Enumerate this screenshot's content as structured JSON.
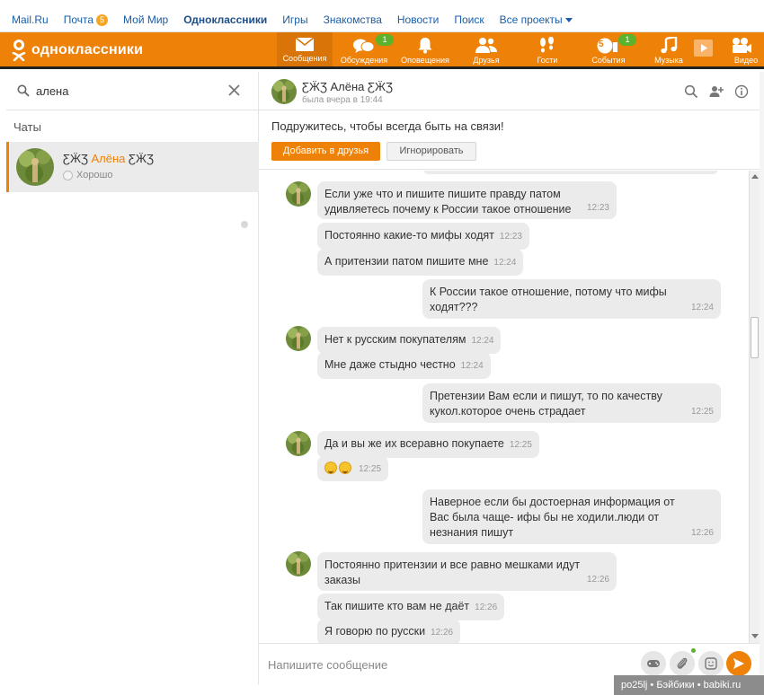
{
  "topbar": {
    "links": [
      "Mail.Ru",
      "Почта",
      "Мой Мир",
      "Одноклассники",
      "Игры",
      "Знакомства",
      "Новости",
      "Поиск",
      "Все проекты"
    ],
    "mail_badge": "5"
  },
  "header": {
    "logo_text": "одноклассники",
    "nav": [
      {
        "label": "Сообщения",
        "badge": ""
      },
      {
        "label": "Обсуждения",
        "badge": "1"
      },
      {
        "label": "Оповещения",
        "badge": ""
      },
      {
        "label": "Друзья",
        "badge": ""
      },
      {
        "label": "Гости",
        "badge": ""
      },
      {
        "label": "События",
        "badge": "1"
      },
      {
        "label": "Музыка",
        "badge": ""
      },
      {
        "label": "Видео",
        "badge": ""
      }
    ],
    "events_counter": "5"
  },
  "sidebar": {
    "search_value": "алена",
    "chats_heading": "Чаты",
    "chat": {
      "name_prefix": "ƸӜƷ ",
      "name_highlight": "Алёна",
      "name_suffix": " ƸӜƷ",
      "status": "Хорошо"
    }
  },
  "conversation": {
    "name": "ƸӜƷ Алёна ƸӜƷ",
    "last_seen": "была вчера в 19:44",
    "friend_prompt": "Подружитесь, чтобы всегда быть на связи!",
    "add_friend_label": "Добавить в друзья",
    "ignore_label": "Игнорировать",
    "composer_placeholder": "Напишите сообщение",
    "messages": [
      {
        "from": "them",
        "text": "Если уже что и пишите пишите правду патом удивляетесь почему к России такое отношение",
        "time": "12:23"
      },
      {
        "from": "them",
        "text": "Постоянно какие-то мифы ходят",
        "time": "12:23"
      },
      {
        "from": "them",
        "text": "А притензии патом пишите мне",
        "time": "12:24"
      },
      {
        "from": "me",
        "text": "К России такое отношение, потому что мифы ходят???",
        "time": "12:24"
      },
      {
        "from": "them",
        "text": "Нет к русским покупателям",
        "time": "12:24"
      },
      {
        "from": "them",
        "text": "Мне даже стыдно честно",
        "time": "12:24"
      },
      {
        "from": "me",
        "text": "Претензии Вам если и пишут, то по качеству кукол.которое очень страдает",
        "time": "12:25"
      },
      {
        "from": "them",
        "text": "Да и вы же их всеравно покупаете",
        "time": "12:25"
      },
      {
        "from": "them",
        "text": "",
        "emoji": 2,
        "time": "12:25"
      },
      {
        "from": "me",
        "text": "Наверное если бы достоерная информация от Вас была чаще- ифы бы не ходили.люди от незнания пишут",
        "time": "12:26"
      },
      {
        "from": "them",
        "text": "Постоянно притензии и все равно мешками идут заказы",
        "time": "12:26"
      },
      {
        "from": "them",
        "text": "Так пишите кто вам не даёт",
        "time": "12:26"
      },
      {
        "from": "them",
        "text": "Я говорю по русски",
        "time": "12:26"
      }
    ]
  },
  "watermark": "po25lj • Бэйбики • babiki.ru",
  "colors": {
    "brand": "#ee8208",
    "link": "#1a5ea8",
    "bubble": "#ebebeb",
    "badge_green": "#5cb32b"
  }
}
